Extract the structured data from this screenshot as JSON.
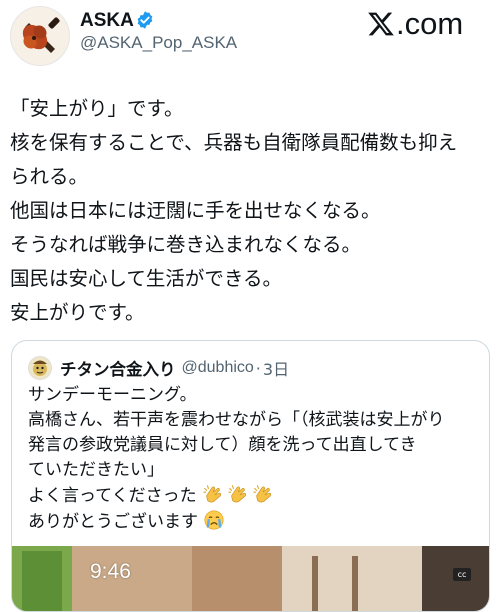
{
  "header": {
    "display_name": "ASKA",
    "handle": "@ASKA_Pop_ASKA",
    "brand_text": ".com",
    "verified_color": "#1d9bf0"
  },
  "tweet": {
    "lines": [
      "「安上がり」です。",
      "核を保有することで、兵器も自衛隊員配備数も抑え",
      "られる。",
      "他国は日本には迂闊に手を出せなくなる。",
      "そうなれば戦争に巻き込まれなくなる。",
      "国民は安心して生活ができる。",
      "安上がりです。"
    ]
  },
  "quote": {
    "name": "チタン合金入り",
    "handle": "@dubhico",
    "separator": "·",
    "time": "3日",
    "lines": [
      "サンデーモーニング。",
      "高橋さん、若干声を震わせながら「（核武装は安上がり",
      "発言の参政党議員に対して）顔を洗って出直してき",
      "ていただきたい」",
      "よく言ってくださった",
      "ありがとうございます"
    ],
    "emojis": {
      "clap": [
        "clapping-hands-icon",
        "clapping-hands-icon",
        "clapping-hands-icon"
      ],
      "crying": "crying-face-icon"
    },
    "media": {
      "time_overlay": "9:46",
      "badge": "cc"
    }
  }
}
